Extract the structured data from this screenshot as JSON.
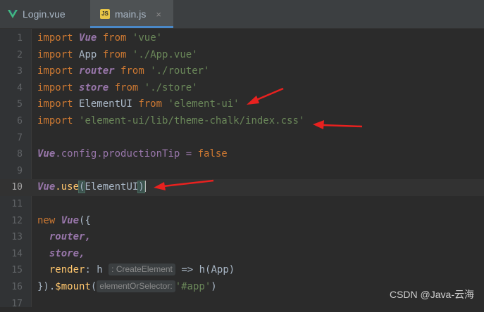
{
  "tabs": [
    {
      "label": "Login.vue",
      "icon": "vue-logo-icon",
      "active": false
    },
    {
      "label": "main.js",
      "icon": "js-file-icon",
      "active": true,
      "close": "×"
    }
  ],
  "js_badge": "JS",
  "line_numbers": [
    "1",
    "2",
    "3",
    "4",
    "5",
    "6",
    "7",
    "8",
    "9",
    "10",
    "11",
    "12",
    "13",
    "14",
    "15",
    "16",
    "17"
  ],
  "code": {
    "import": "import",
    "from": "from",
    "l1": {
      "name": "Vue",
      "src": "'vue'"
    },
    "l2": {
      "name": "App",
      "src": "'./App.vue'"
    },
    "l3": {
      "name": "router",
      "src": "'./router'"
    },
    "l4": {
      "name": "store",
      "src": "'./store'"
    },
    "l5": {
      "name": "ElementUI",
      "src": "'element-ui'"
    },
    "l6": {
      "src": "'element-ui/lib/theme-chalk/index.css'"
    },
    "l8": {
      "obj": "Vue",
      "rest": ".config.productionTip = ",
      "val": "false"
    },
    "l10": {
      "obj": "Vue",
      "method": ".use",
      "open": "(",
      "arg": "ElementUI",
      "close": ")"
    },
    "l12": {
      "kw": "new",
      "cls": "Vue",
      "rest": "({"
    },
    "l13": {
      "text": "router,"
    },
    "l14": {
      "text": "store,"
    },
    "l15": {
      "key": "render",
      "colon": ": ",
      "param": "h",
      "hint": ": CreateElement",
      "arrow": " => ",
      "call": "h",
      "arg": "(App)"
    },
    "l16": {
      "start": "}).",
      "method": "$mount",
      "open": "(",
      "hint": "elementOrSelector:",
      "arg": "'#app'",
      "close": ")"
    }
  },
  "colors": {
    "keyword": "#cc7832",
    "string": "#6a8759",
    "identifier": "#9876aa",
    "annotation_arrow": "#e8211f"
  },
  "watermark": "CSDN @Java-云海"
}
